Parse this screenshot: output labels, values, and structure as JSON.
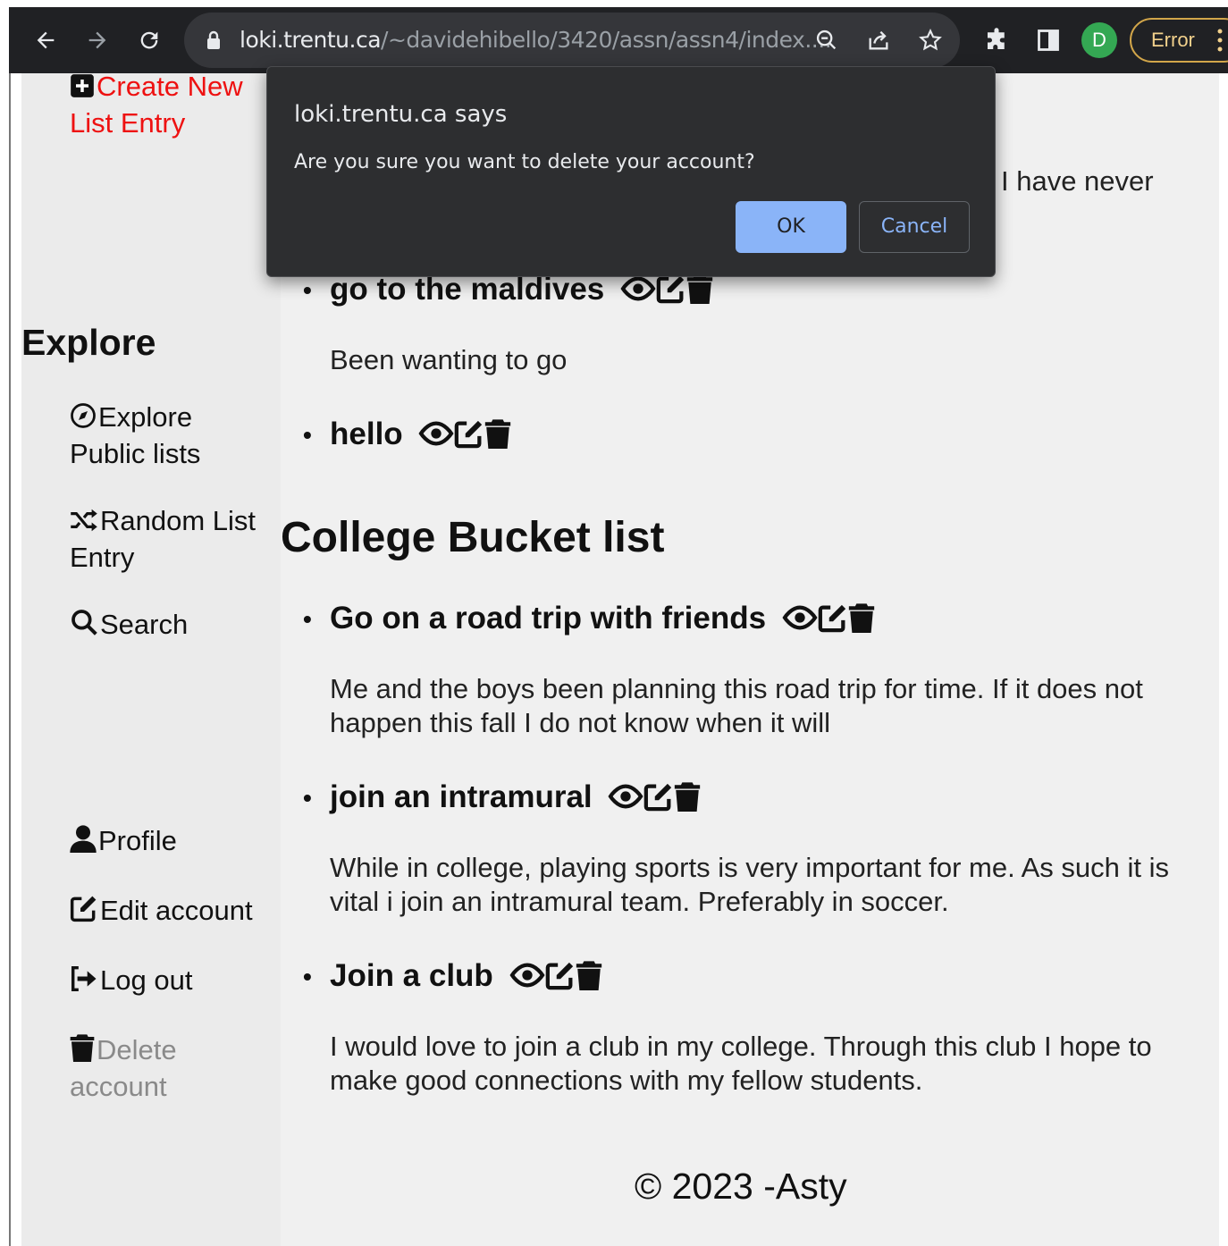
{
  "browser": {
    "url_host": "loki.trentu.ca",
    "url_path": "/~davidehibello/3420/assn/assn4/index....",
    "profile_initial": "D",
    "error_label": "Error"
  },
  "dialog": {
    "title": "loki.trentu.ca says",
    "message": "Are you sure you want to delete your account?",
    "ok_label": "OK",
    "cancel_label": "Cancel"
  },
  "sidebar": {
    "create_new": "Create New List Entry",
    "explore_heading": "Explore",
    "explore_public": "Explore Public lists",
    "random_entry": "Random List Entry",
    "search": "Search",
    "profile": "Profile",
    "edit_account": "Edit account",
    "log_out": "Log out",
    "delete_account": "Delete account"
  },
  "main": {
    "partial_text": "I have never",
    "list1_entries": [
      {
        "title": "go to the maldives",
        "desc": "Been wanting to go"
      },
      {
        "title": "hello",
        "desc": ""
      }
    ],
    "list2": {
      "heading": "College Bucket list",
      "entries": [
        {
          "title": "Go on a road trip with friends",
          "desc": "Me and the boys been planning this road trip for time. If it does not happen this fall I do not know when it will"
        },
        {
          "title": "join an intramural",
          "desc": "While in college, playing sports is very important for me. As such it is vital i join an intramural team. Preferably in soccer."
        },
        {
          "title": "Join a club",
          "desc": "I would love to join a club in my college. Through this club I hope to make good connections with my fellow students."
        }
      ]
    },
    "footer": "© 2023 -Asty"
  }
}
